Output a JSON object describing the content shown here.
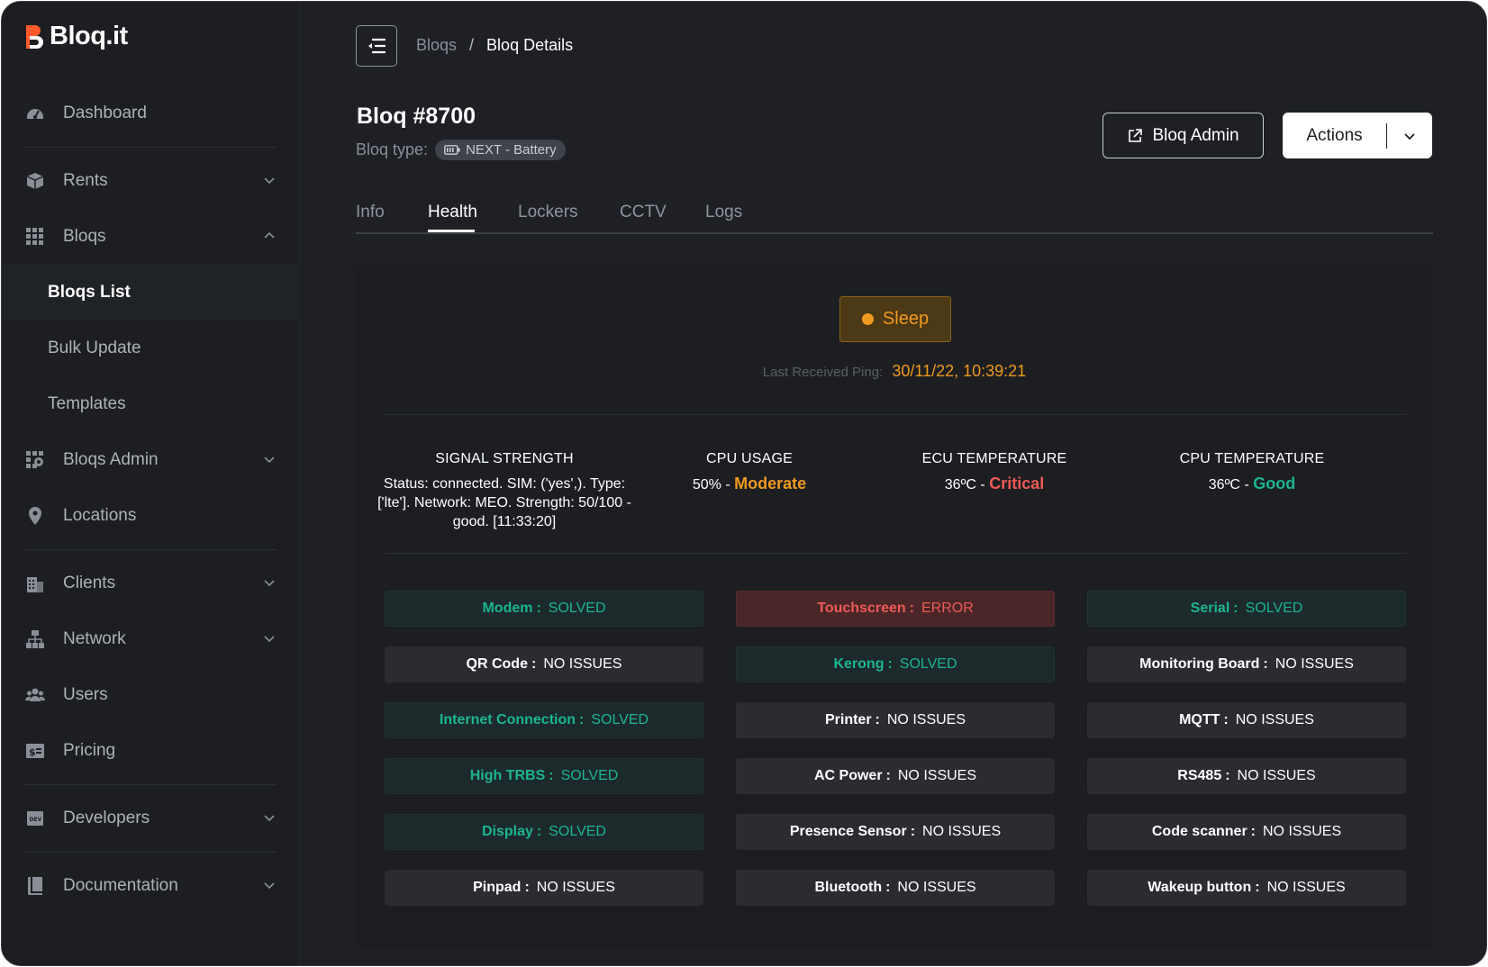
{
  "app": {
    "name": "Bloq.it"
  },
  "sidebar": {
    "items": [
      {
        "label": "Dashboard",
        "icon": "dashboard-gauge-icon"
      },
      {
        "label": "Rents",
        "icon": "box-icon",
        "expandable": true,
        "expanded": false
      },
      {
        "label": "Bloqs",
        "icon": "grid-icon",
        "expandable": true,
        "expanded": true
      },
      {
        "label": "Bloqs Admin",
        "icon": "admin-grid-icon",
        "expandable": true,
        "expanded": false
      },
      {
        "label": "Locations",
        "icon": "map-pin-icon"
      },
      {
        "label": "Clients",
        "icon": "building-icon",
        "expandable": true,
        "expanded": false
      },
      {
        "label": "Network",
        "icon": "network-icon",
        "expandable": true,
        "expanded": false
      },
      {
        "label": "Users",
        "icon": "users-icon"
      },
      {
        "label": "Pricing",
        "icon": "pricing-icon"
      },
      {
        "label": "Developers",
        "icon": "dev-icon",
        "expandable": true,
        "expanded": false
      },
      {
        "label": "Documentation",
        "icon": "book-icon",
        "expandable": true,
        "expanded": false
      }
    ],
    "bloqs_sub": [
      {
        "label": "Bloqs List",
        "active": true
      },
      {
        "label": "Bulk Update",
        "active": false
      },
      {
        "label": "Templates",
        "active": false
      }
    ]
  },
  "breadcrumb": {
    "parent": "Bloqs",
    "separator": "/",
    "current": "Bloq Details"
  },
  "header": {
    "title": "Bloq #8700",
    "type_label": "Bloq type:",
    "type_value": "NEXT - Battery",
    "admin_button": "Bloq Admin",
    "actions_button": "Actions"
  },
  "tabs": [
    {
      "label": "Info",
      "active": false
    },
    {
      "label": "Health",
      "active": true
    },
    {
      "label": "Lockers",
      "active": false
    },
    {
      "label": "CCTV",
      "active": false
    },
    {
      "label": "Logs",
      "active": false
    }
  ],
  "health": {
    "status": "Sleep",
    "status_color": "#f09a1f",
    "ping_label": "Last Received Ping:",
    "ping_value": "30/11/22, 10:39:21",
    "metrics": [
      {
        "title": "SIGNAL STRENGTH",
        "value": "Status: connected. SIM: ('yes',). Type: ['lte']. Network: MEO. Strength: 50/100 - good. [11:33:20]",
        "level": "",
        "level_color": ""
      },
      {
        "title": "CPU USAGE",
        "value": "50%",
        "level": "Moderate",
        "level_color": "#f09a1f"
      },
      {
        "title": "ECU TEMPERATURE",
        "value": "36ºC",
        "level": "Critical",
        "level_color": "#ee5a56"
      },
      {
        "title": "CPU TEMPERATURE",
        "value": "36ºC",
        "level": "Good",
        "level_color": "#1bb58f"
      }
    ],
    "components": [
      {
        "name": "Modem",
        "status": "SOLVED"
      },
      {
        "name": "Touchscreen",
        "status": "ERROR"
      },
      {
        "name": "Serial",
        "status": "SOLVED"
      },
      {
        "name": "QR Code",
        "status": "NO ISSUES"
      },
      {
        "name": "Kerong",
        "status": "SOLVED"
      },
      {
        "name": "Monitoring Board",
        "status": "NO ISSUES"
      },
      {
        "name": "Internet Connection",
        "status": "SOLVED"
      },
      {
        "name": "Printer",
        "status": "NO ISSUES"
      },
      {
        "name": "MQTT",
        "status": "NO ISSUES"
      },
      {
        "name": "High TRBS",
        "status": "SOLVED"
      },
      {
        "name": "AC Power",
        "status": "NO ISSUES"
      },
      {
        "name": "RS485",
        "status": "NO ISSUES"
      },
      {
        "name": "Display",
        "status": "SOLVED"
      },
      {
        "name": "Presence Sensor",
        "status": "NO ISSUES"
      },
      {
        "name": "Code scanner",
        "status": "NO ISSUES"
      },
      {
        "name": "Pinpad",
        "status": "NO ISSUES"
      },
      {
        "name": "Bluetooth",
        "status": "NO ISSUES"
      },
      {
        "name": "Wakeup button",
        "status": "NO ISSUES"
      }
    ]
  }
}
